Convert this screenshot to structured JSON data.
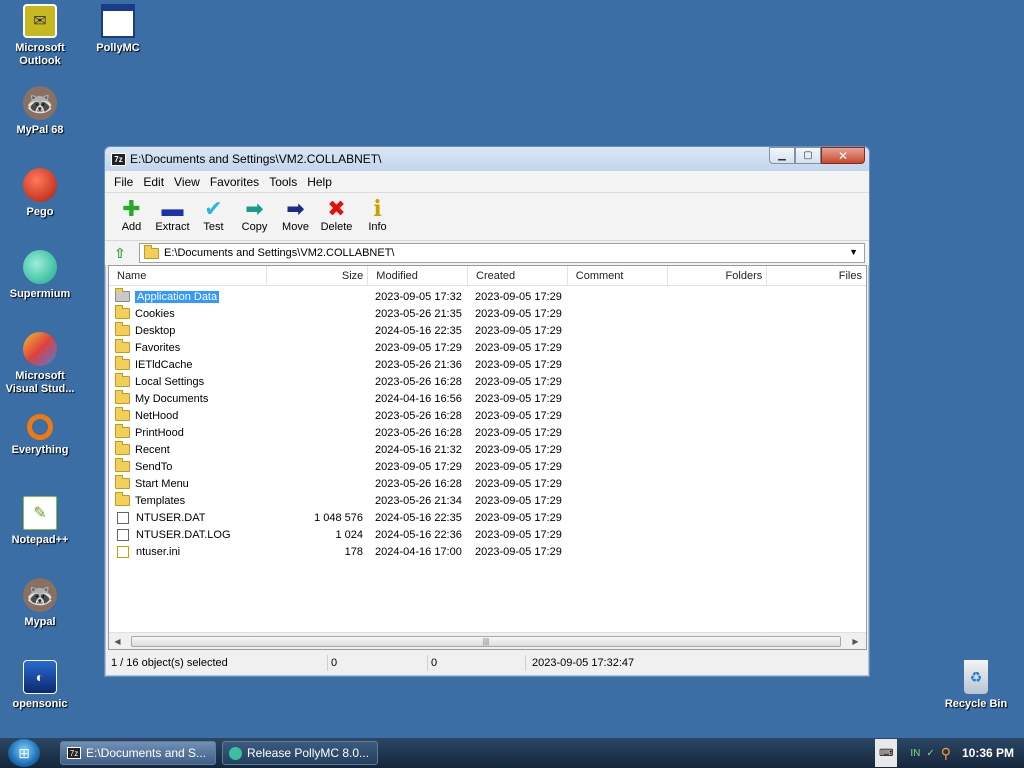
{
  "desktop": {
    "icons": [
      {
        "label": "Microsoft Outlook",
        "icon": "outlook-icon"
      },
      {
        "label": "PollyMC",
        "icon": "window-icon"
      },
      {
        "label": "MyPal 68",
        "icon": "raccoon-icon"
      },
      {
        "label": "Pego",
        "icon": "red-ball-icon"
      },
      {
        "label": "Supermium",
        "icon": "supermium-icon"
      },
      {
        "label": "Microsoft Visual Stud...",
        "icon": "visual-studio-icon"
      },
      {
        "label": "Everything",
        "icon": "everything-icon"
      },
      {
        "label": "Notepad++",
        "icon": "notepad-icon"
      },
      {
        "label": "Mypal",
        "icon": "raccoon-icon"
      },
      {
        "label": "opensonic",
        "icon": "opensonic-icon"
      },
      {
        "label": "Recycle Bin",
        "icon": "recycle-bin-icon"
      }
    ]
  },
  "window": {
    "app_icon_text": "7z",
    "title": "E:\\Documents and Settings\\VM2.COLLABNET\\",
    "menu": [
      "File",
      "Edit",
      "View",
      "Favorites",
      "Tools",
      "Help"
    ],
    "toolbar": [
      {
        "label": "Add",
        "icon": "plus-icon",
        "color": "#22aa22",
        "glyph": "✚"
      },
      {
        "label": "Extract",
        "icon": "minus-icon",
        "color": "#1a33aa",
        "glyph": "▬"
      },
      {
        "label": "Test",
        "icon": "check-icon",
        "color": "#28b8d8",
        "glyph": "✔"
      },
      {
        "label": "Copy",
        "icon": "copy-arrow-icon",
        "color": "#1a9a8a",
        "glyph": "➡"
      },
      {
        "label": "Move",
        "icon": "move-arrow-icon",
        "color": "#1a2a8a",
        "glyph": "➡"
      },
      {
        "label": "Delete",
        "icon": "delete-x-icon",
        "color": "#dd1111",
        "glyph": "✖"
      },
      {
        "label": "Info",
        "icon": "info-icon",
        "color": "#c8a000",
        "glyph": "i"
      }
    ],
    "address": "E:\\Documents and Settings\\VM2.COLLABNET\\",
    "columns": {
      "name": "Name",
      "size": "Size",
      "modified": "Modified",
      "created": "Created",
      "comment": "Comment",
      "folders": "Folders",
      "files": "Files"
    },
    "rows": [
      {
        "name": "Application Data",
        "type": "folder",
        "size": "",
        "modified": "2023-09-05 17:32",
        "created": "2023-09-05 17:29",
        "selected": true
      },
      {
        "name": "Cookies",
        "type": "folder",
        "size": "",
        "modified": "2023-05-26 21:35",
        "created": "2023-09-05 17:29"
      },
      {
        "name": "Desktop",
        "type": "folder",
        "size": "",
        "modified": "2024-05-16 22:35",
        "created": "2023-09-05 17:29"
      },
      {
        "name": "Favorites",
        "type": "folder",
        "size": "",
        "modified": "2023-09-05 17:29",
        "created": "2023-09-05 17:29"
      },
      {
        "name": "IETldCache",
        "type": "folder",
        "size": "",
        "modified": "2023-05-26 21:36",
        "created": "2023-09-05 17:29"
      },
      {
        "name": "Local Settings",
        "type": "folder",
        "size": "",
        "modified": "2023-05-26 16:28",
        "created": "2023-09-05 17:29"
      },
      {
        "name": "My Documents",
        "type": "folder",
        "size": "",
        "modified": "2024-04-16 16:56",
        "created": "2023-09-05 17:29"
      },
      {
        "name": "NetHood",
        "type": "folder",
        "size": "",
        "modified": "2023-05-26 16:28",
        "created": "2023-09-05 17:29"
      },
      {
        "name": "PrintHood",
        "type": "folder",
        "size": "",
        "modified": "2023-05-26 16:28",
        "created": "2023-09-05 17:29"
      },
      {
        "name": "Recent",
        "type": "folder",
        "size": "",
        "modified": "2024-05-16 21:32",
        "created": "2023-09-05 17:29"
      },
      {
        "name": "SendTo",
        "type": "folder",
        "size": "",
        "modified": "2023-09-05 17:29",
        "created": "2023-09-05 17:29"
      },
      {
        "name": "Start Menu",
        "type": "folder",
        "size": "",
        "modified": "2023-05-26 16:28",
        "created": "2023-09-05 17:29"
      },
      {
        "name": "Templates",
        "type": "folder",
        "size": "",
        "modified": "2023-05-26 21:34",
        "created": "2023-09-05 17:29"
      },
      {
        "name": "NTUSER.DAT",
        "type": "file",
        "size": "1 048 576",
        "modified": "2024-05-16 22:35",
        "created": "2023-09-05 17:29"
      },
      {
        "name": "NTUSER.DAT.LOG",
        "type": "file",
        "size": "1 024",
        "modified": "2024-05-16 22:36",
        "created": "2023-09-05 17:29"
      },
      {
        "name": "ntuser.ini",
        "type": "file",
        "size": "178",
        "modified": "2024-04-16 17:00",
        "created": "2023-09-05 17:29"
      }
    ],
    "status": {
      "selection": "1 / 16 object(s) selected",
      "size1": "0",
      "size2": "0",
      "date": "2023-09-05 17:32:47"
    }
  },
  "taskbar": {
    "buttons": [
      {
        "label": "E:\\Documents and S...",
        "icon": "7zip-icon",
        "active": true
      },
      {
        "label": "Release PollyMC 8.0...",
        "icon": "browser-icon",
        "active": false
      }
    ],
    "tray_lang": "IN",
    "clock": "10:36 PM"
  },
  "colors": {
    "desktop": "#3a6ea5",
    "selection": "#3399ff",
    "folder": "#f2cf5b"
  }
}
